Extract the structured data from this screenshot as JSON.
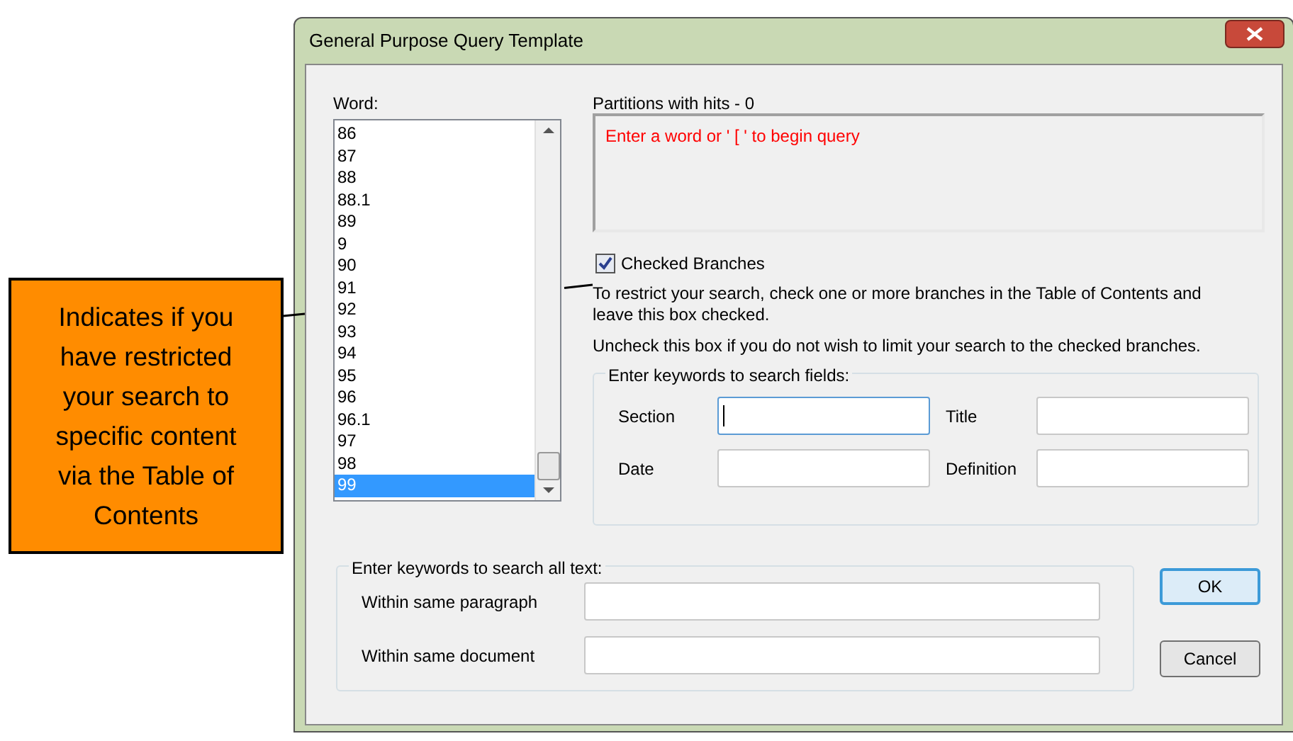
{
  "window": {
    "title": "General Purpose Query Template"
  },
  "word_list": {
    "label": "Word:",
    "items": [
      {
        "text": "86",
        "selected": false
      },
      {
        "text": "87",
        "selected": false
      },
      {
        "text": "88",
        "selected": false
      },
      {
        "text": "88.1",
        "selected": false
      },
      {
        "text": "89",
        "selected": false
      },
      {
        "text": "9",
        "selected": false
      },
      {
        "text": "90",
        "selected": false
      },
      {
        "text": "91",
        "selected": false
      },
      {
        "text": "92",
        "selected": false
      },
      {
        "text": "93",
        "selected": false
      },
      {
        "text": "94",
        "selected": false
      },
      {
        "text": "95",
        "selected": false
      },
      {
        "text": "96",
        "selected": false
      },
      {
        "text": "96.1",
        "selected": false
      },
      {
        "text": "97",
        "selected": false
      },
      {
        "text": "98",
        "selected": false
      },
      {
        "text": "99",
        "selected": true
      }
    ]
  },
  "partitions": {
    "label": "Partitions with hits - 0",
    "message": "Enter a word or ' [ ' to begin query"
  },
  "checked_branches": {
    "label": "Checked Branches",
    "checked": true,
    "hints": [
      "To restrict your search, check one or more branches in the Table of Contents and leave this box checked.",
      "Uncheck this box if you do not wish to limit your search to the checked branches."
    ]
  },
  "search_fields": {
    "legend": "Enter keywords to search fields:",
    "fields": [
      {
        "label": "Section",
        "focused": true
      },
      {
        "label": "Title",
        "focused": false
      },
      {
        "label": "Date",
        "focused": false
      },
      {
        "label": "Definition",
        "focused": false
      }
    ]
  },
  "all_text": {
    "legend": "Enter keywords to search all text:",
    "fields": [
      {
        "label": "Within same paragraph",
        "focused": false
      },
      {
        "label": "Within same document",
        "focused": false
      }
    ]
  },
  "buttons": [
    {
      "label": "OK",
      "default": true
    },
    {
      "label": "Cancel",
      "default": false
    }
  ],
  "callout": {
    "text": "Indicates if you have restricted your search to specific content via the Table of Contents"
  }
}
